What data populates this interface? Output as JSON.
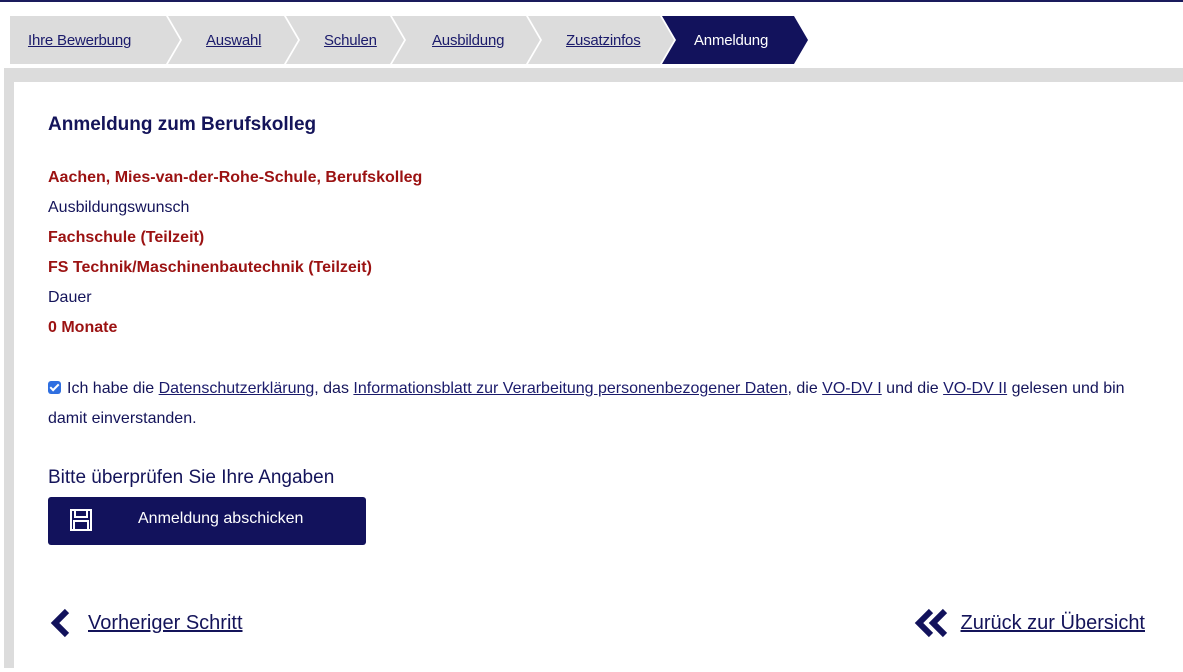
{
  "steps": [
    {
      "label": "Ihre Bewerbung"
    },
    {
      "label": "Auswahl"
    },
    {
      "label": "Schulen"
    },
    {
      "label": "Ausbildung"
    },
    {
      "label": "Zusatzinfos"
    },
    {
      "label": "Anmeldung"
    }
  ],
  "main": {
    "heading": "Anmeldung zum Berufskolleg",
    "school": "Aachen, Mies-van-der-Rohe-Schule, Berufskolleg",
    "wish_label": "Ausbildungswunsch",
    "type": "Fachschule (Teilzeit)",
    "program": "FS Technik/Maschinenbautechnik (Teilzeit)",
    "duration_label": "Dauer",
    "duration_value": "0 Monate"
  },
  "consent": {
    "checked": true,
    "text_1": "Ich habe die ",
    "link_privacy": "Datenschutzerklärung",
    "text_2": ", das ",
    "link_info": "Informationsblatt zur Verarbeitung personenbezogener Daten",
    "text_3": ", die ",
    "link_vodv1": "VO-DV I",
    "text_4": " und die ",
    "link_vodv2": "VO-DV II",
    "text_5": " gelesen und bin damit einverstanden."
  },
  "review_text": "Bitte überprüfen Sie Ihre Angaben",
  "submit_label": "Anmeldung abschicken",
  "nav": {
    "prev_label": "Vorheriger Schritt",
    "back_label": "Zurück zur Übersicht"
  },
  "colors": {
    "navy": "#12125c",
    "accent_red": "#9b1212",
    "step_bg": "#dcdcdc"
  }
}
